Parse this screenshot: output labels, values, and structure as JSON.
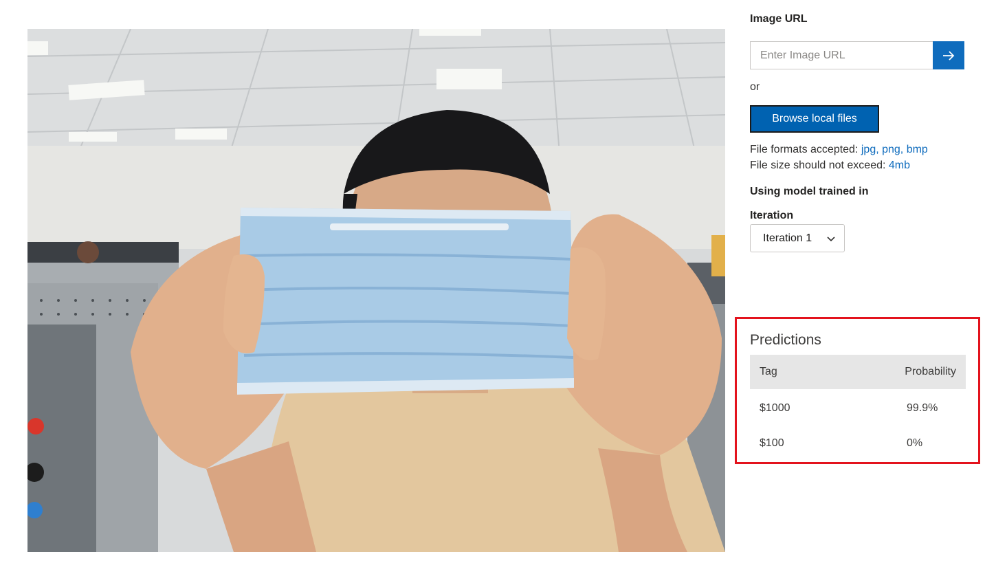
{
  "form": {
    "image_url_label": "Image URL",
    "image_url_placeholder": "Enter Image URL",
    "submit_icon": "arrow-right-icon",
    "or_text": "or",
    "browse_label": "Browse local files",
    "formats_prefix": "File formats accepted:",
    "formats_value": "jpg, png, bmp",
    "size_prefix": "File size should not exceed:",
    "size_value": "4mb",
    "model_label": "Using model trained in",
    "iteration_label": "Iteration",
    "iteration_selected": "Iteration 1",
    "iteration_icon": "chevron-down-icon"
  },
  "predictions": {
    "title": "Predictions",
    "headers": {
      "tag": "Tag",
      "probability": "Probability"
    },
    "rows": [
      {
        "tag": "$1000",
        "probability": "99.9%"
      },
      {
        "tag": "$100",
        "probability": "0%"
      }
    ]
  },
  "colors": {
    "accent": "#0f6cbd",
    "browse_button": "#0062b1",
    "highlight_border": "#e3131d",
    "table_header": "#e6e6e6"
  }
}
